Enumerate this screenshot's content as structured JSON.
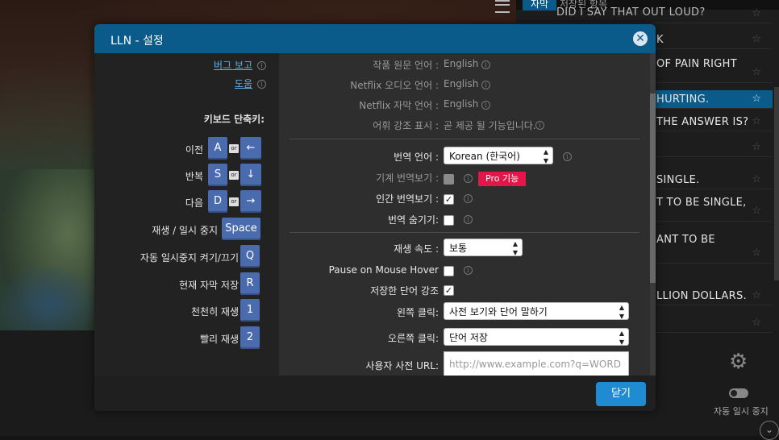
{
  "app": {
    "title": "LLN - 설정"
  },
  "subtitles": {
    "tab_active": "자막",
    "tab_inactive": "저장된 항목",
    "rows": [
      {
        "text": "DID I SAY THAT OUT LOUD?",
        "highlight": false
      },
      {
        "text": "K",
        "highlight": false
      },
      {
        "text": "OF PAIN RIGHT",
        "highlight": false
      },
      {
        "text": "HURTING.",
        "highlight": true
      },
      {
        "text": "THE ANSWER IS?",
        "highlight": false
      },
      {
        "text": "",
        "highlight": false
      },
      {
        "text": "SINGLE.",
        "highlight": false
      },
      {
        "text": "T TO BE SINGLE,",
        "highlight": false
      },
      {
        "text": "ANT TO BE",
        "highlight": false
      },
      {
        "text": "LLION DOLLARS.",
        "highlight": false
      },
      {
        "text": "",
        "highlight": false
      }
    ],
    "star": "☆",
    "autopause_label": "자동 일시 중지"
  },
  "left": {
    "bug_report": "버그 보고",
    "help": "도움",
    "shortcuts_title": "키보드 단축키:",
    "or": "or",
    "shortcuts": [
      {
        "label": "이전",
        "key": "A",
        "alt": "←"
      },
      {
        "label": "반복",
        "key": "S",
        "alt": "↓"
      },
      {
        "label": "다음",
        "key": "D",
        "alt": "→"
      },
      {
        "label": "재생 / 일시 중지",
        "key": "Space"
      },
      {
        "label": "자동 일시중지 켜기/끄기",
        "key": "Q"
      },
      {
        "label": "현재 자막 저장",
        "key": "R"
      },
      {
        "label": "천천히 재생",
        "key": "1"
      },
      {
        "label": "빨리 재생",
        "key": "2"
      }
    ]
  },
  "settings": {
    "source_lang_label": "작품 원문 언어 :",
    "source_lang_value": "English",
    "audio_lang_label": "Netflix 오디오 언어 :",
    "audio_lang_value": "English",
    "sub_lang_label": "Netflix 자막 언어 :",
    "sub_lang_value": "English",
    "vocab_label": "어휘 강조 표시 :",
    "vocab_value": "곧 제공 될 기능입니다.",
    "translation_lang_label": "번역 언어 :",
    "translation_lang_value": "Korean (한국어)",
    "machine_trans_label": "기계 번역보기 :",
    "pro_badge": "Pro 기능",
    "human_trans_label": "인간 번역보기 :",
    "hide_trans_label": "번역 숨기기:",
    "speed_label": "재생 속도 :",
    "speed_value": "보통",
    "pause_hover_label": "Pause on Mouse Hover",
    "highlight_saved_label": "저장한 단어 강조",
    "left_click_label": "왼쪽 클릭:",
    "left_click_value": "사전 보기와 단어 말하기",
    "right_click_label": "오른쪽 클릭:",
    "right_click_value": "단어 저장",
    "dict_url_label": "사용자 사전 URL:",
    "dict_url_placeholder": "http://www.example.com?q=WORD"
  },
  "footer": {
    "close_label": "닫기"
  }
}
